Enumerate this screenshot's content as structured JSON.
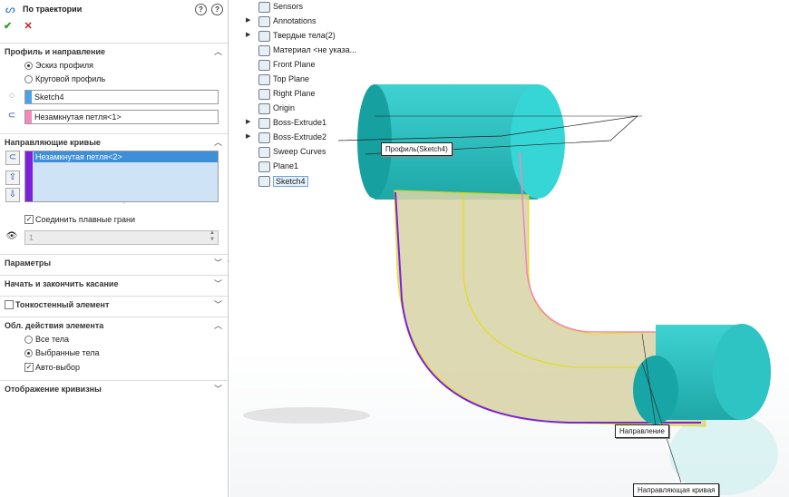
{
  "feature": {
    "title": "По траектории",
    "ok": "✔",
    "cancel": "✕"
  },
  "profile_section": {
    "header": "Профиль и направление",
    "radio_sketch": "Эскиз профиля",
    "radio_circular": "Круговой профиль",
    "profile_value": "Sketch4",
    "path_value": "Незамкнутая петля<1>"
  },
  "guides_section": {
    "header": "Направляющие кривые",
    "guide_item": "Незамкнутая петля<2>",
    "merge_faces": "Соединить плавные грани",
    "count_value": "1"
  },
  "collapsed_sections": {
    "options": "Параметры",
    "tangency": "Начать и закончить касание",
    "thin": "Тонкостенный элемент"
  },
  "scope_section": {
    "header": "Обл. действия элемента",
    "all_bodies": "Все тела",
    "selected_bodies": "Выбранные тела",
    "auto_select": "Авто-выбор"
  },
  "curvature": {
    "header": "Отображение кривизны"
  },
  "tree": [
    {
      "label": "Sensors",
      "arrow": ""
    },
    {
      "label": "Annotations",
      "arrow": "▶"
    },
    {
      "label": "Твердые тела(2)",
      "arrow": "▶"
    },
    {
      "label": "Материал <не указа...",
      "arrow": ""
    },
    {
      "label": "Front Plane",
      "arrow": ""
    },
    {
      "label": "Top Plane",
      "arrow": ""
    },
    {
      "label": "Right Plane",
      "arrow": ""
    },
    {
      "label": "Origin",
      "arrow": ""
    },
    {
      "label": "Boss-Extrude1",
      "arrow": "▶"
    },
    {
      "label": "Boss-Extrude2",
      "arrow": "▶"
    },
    {
      "label": "Sweep Curves",
      "arrow": ""
    },
    {
      "label": "Plane1",
      "arrow": ""
    },
    {
      "label": "Sketch4",
      "arrow": ""
    }
  ],
  "callouts": {
    "profile": "Профиль(Sketch4)",
    "path": "Направление",
    "guide": "Направляющая кривая"
  },
  "colors": {
    "profile_swatch": "#4aa3e8",
    "path_swatch": "#f08ab8",
    "guide_swatch": "#7b22d6",
    "selection_bg": "#cfe3f7",
    "body": "#2ec4c4",
    "sweep": "#d9d4a8"
  }
}
